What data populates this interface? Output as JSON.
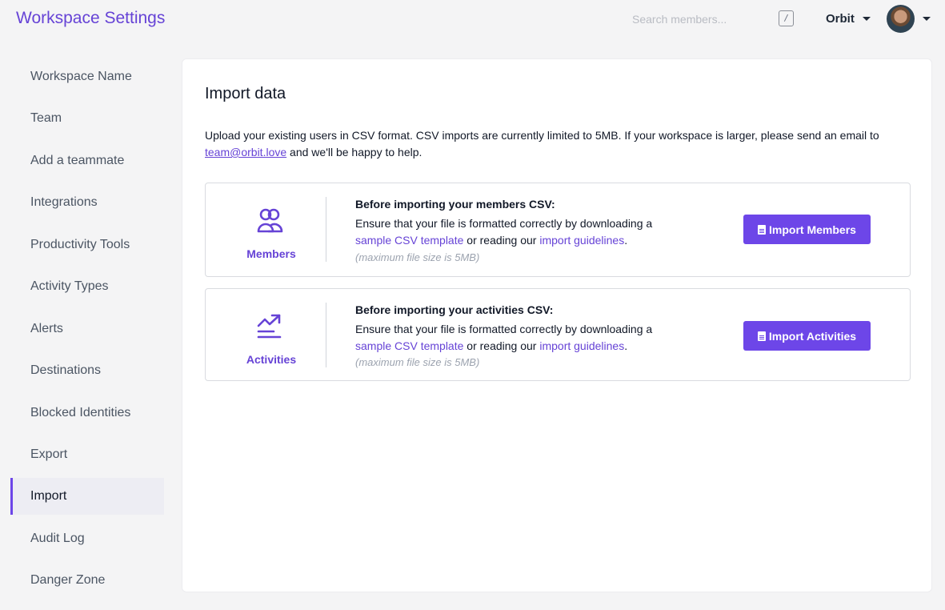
{
  "header": {
    "title": "Workspace Settings",
    "search_placeholder": "Search members...",
    "search_shortcut": "/",
    "org_name": "Orbit"
  },
  "sidebar": {
    "items": [
      {
        "label": "Workspace Name"
      },
      {
        "label": "Team"
      },
      {
        "label": "Add a teammate"
      },
      {
        "label": "Integrations"
      },
      {
        "label": "Productivity Tools"
      },
      {
        "label": "Activity Types"
      },
      {
        "label": "Alerts"
      },
      {
        "label": "Destinations"
      },
      {
        "label": "Blocked Identities"
      },
      {
        "label": "Export"
      },
      {
        "label": "Import",
        "active": true
      },
      {
        "label": "Audit Log"
      },
      {
        "label": "Danger Zone"
      }
    ]
  },
  "main": {
    "title": "Import data",
    "intro_text": "Upload your existing users in CSV format. CSV imports are currently limited to 5MB. If your workspace is larger, please send an email to ",
    "intro_email": "team@orbit.love",
    "intro_suffix": " and we'll be happy to help.",
    "cards": [
      {
        "label": "Members",
        "icon": "users-icon",
        "heading": "Before importing your members CSV:",
        "desc_prefix": "Ensure that your file is formatted correctly by downloading a ",
        "link1": "sample CSV template",
        "desc_middle": " or reading our ",
        "link2": "import guidelines",
        "desc_suffix": ".",
        "note": "(maximum file size is 5MB)",
        "button_label": "Import Members"
      },
      {
        "label": "Activities",
        "icon": "trending-up-icon",
        "heading": "Before importing your activities CSV:",
        "desc_prefix": "Ensure that your file is formatted correctly by downloading a ",
        "link1": "sample CSV template",
        "desc_middle": " or reading our ",
        "link2": "import guidelines",
        "desc_suffix": ".",
        "note": "(maximum file size is 5MB)",
        "button_label": "Import Activities"
      }
    ]
  },
  "colors": {
    "accent": "#6d46e8",
    "brand_text": "#6643d6",
    "background": "#f4f4f5"
  }
}
